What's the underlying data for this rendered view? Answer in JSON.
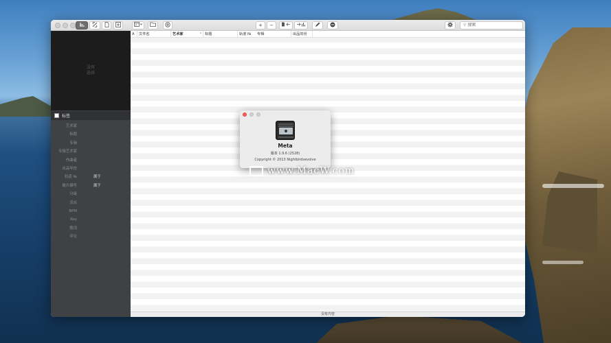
{
  "window": {
    "toolbar": {
      "add_label": "+",
      "remove_label": "−",
      "search_placeholder": "搜索"
    },
    "sidebar": {
      "artwork_placeholder": [
        "没有",
        "选择"
      ],
      "tags_header": "标签",
      "fields": [
        {
          "label": "艺术家",
          "value": ""
        },
        {
          "label": "标题",
          "value": ""
        },
        {
          "label": "专辑",
          "value": ""
        },
        {
          "label": "专辑艺术家",
          "value": ""
        },
        {
          "label": "作曲者",
          "value": ""
        },
        {
          "label": "出品年份",
          "value": ""
        },
        {
          "label": "轨道 №",
          "value": "属于"
        },
        {
          "label": "碟片编号",
          "value": "属于"
        },
        {
          "label": "分级",
          "value": ""
        },
        {
          "label": "流派",
          "value": ""
        },
        {
          "label": "BPM",
          "value": ""
        },
        {
          "label": "Key",
          "value": ""
        },
        {
          "label": "歌词",
          "value": ""
        },
        {
          "label": "评论",
          "value": ""
        }
      ]
    },
    "table": {
      "columns": [
        "A",
        "文件名",
        "艺术家",
        "标题",
        "轨道 №",
        "专辑",
        "出品年份"
      ]
    },
    "statusbar": "没有内容"
  },
  "about": {
    "app_name": "Meta",
    "version": "版本 1.9.6 (2528)",
    "copyright": "Copyright © 2013 Nightbirdsevolve"
  },
  "watermark": "www.MacW.com",
  "colors": {
    "close_red": "#fe5f57",
    "sidebar_bg": "#3f4144",
    "artwork_bg": "#1c1c1c"
  }
}
